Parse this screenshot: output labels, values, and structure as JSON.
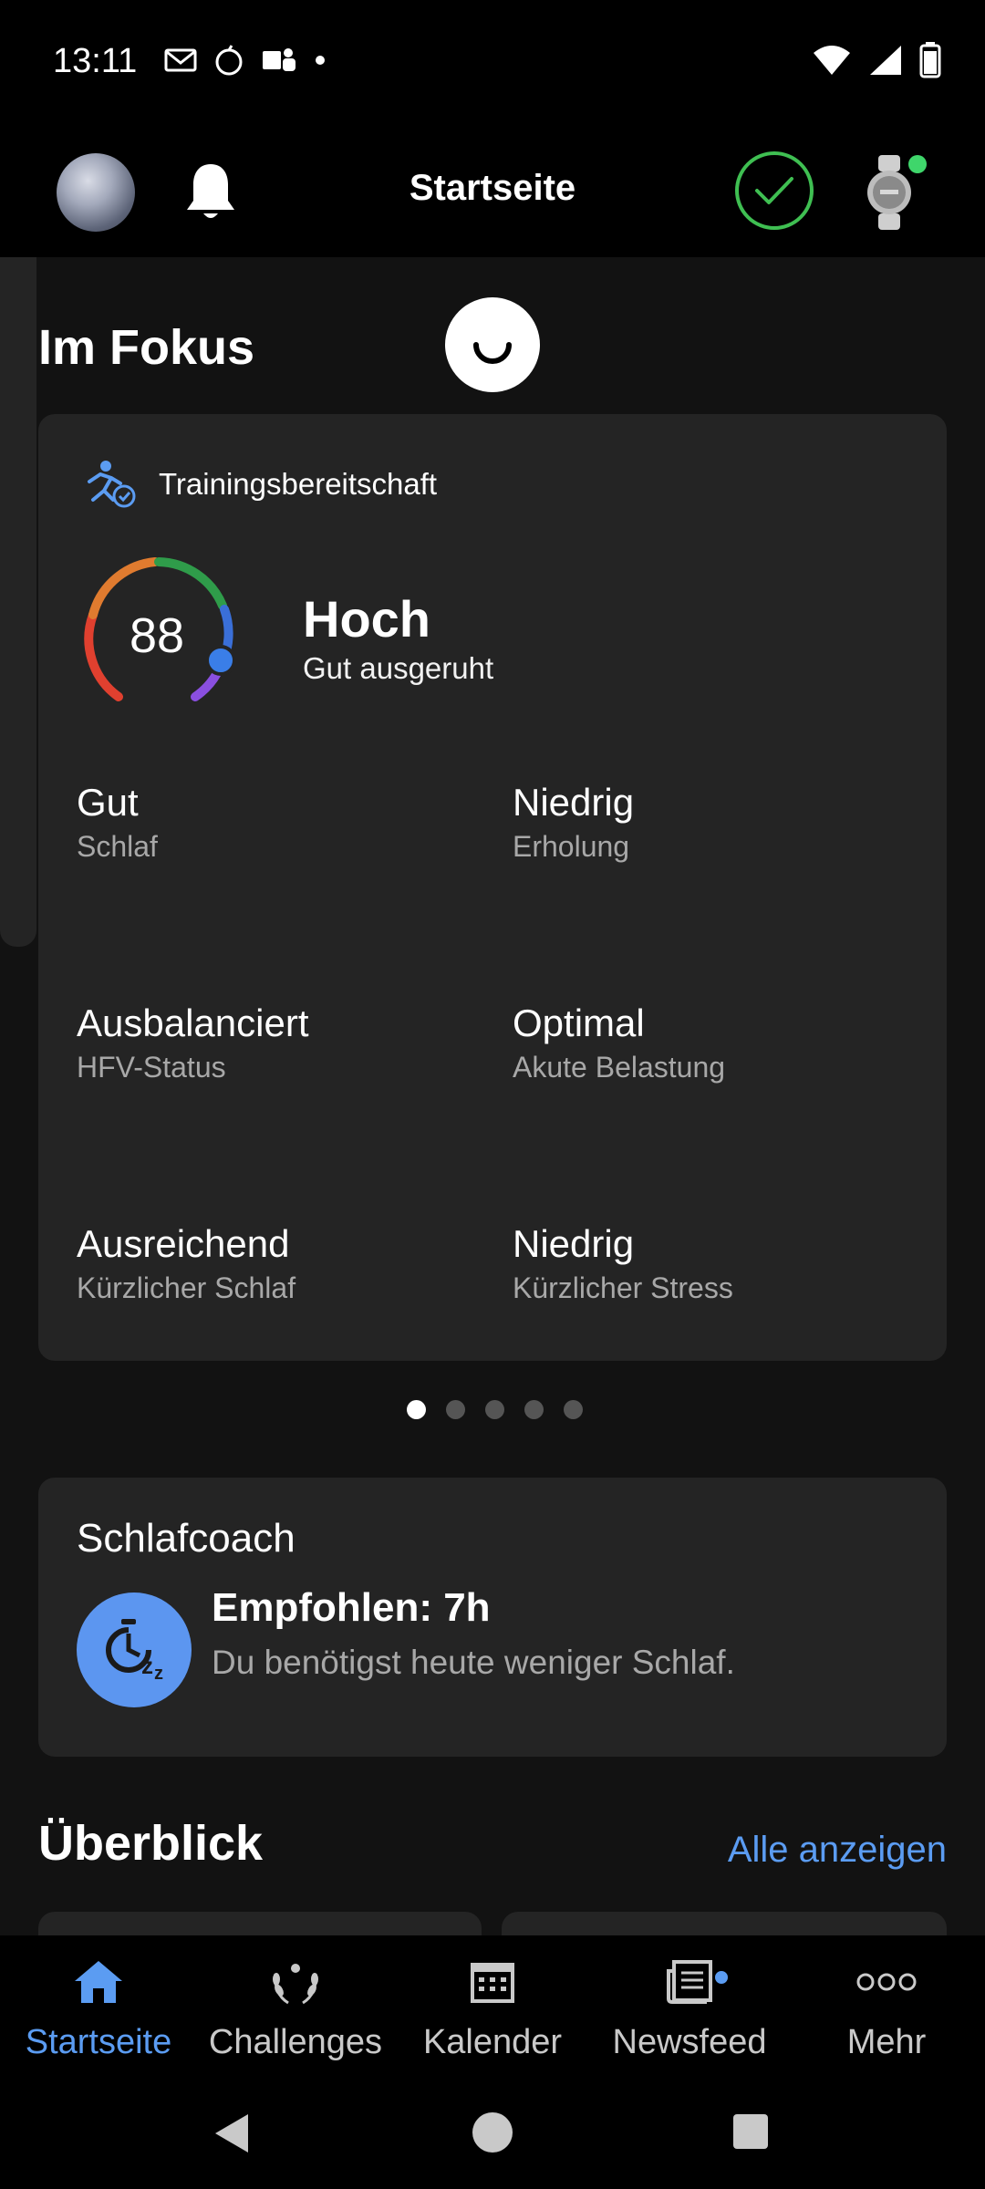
{
  "status_bar": {
    "time": "13:11"
  },
  "app_bar": {
    "title": "Startseite"
  },
  "focus": {
    "title": "Im Fokus",
    "card": {
      "title": "Trainingsbereitschaft",
      "score": "88",
      "level": "Hoch",
      "level_sub": "Gut ausgeruht",
      "metrics": [
        {
          "value": "Gut",
          "label": "Schlaf"
        },
        {
          "value": "Niedrig",
          "label": "Erholung"
        },
        {
          "value": "Ausbalanciert",
          "label": "HFV-Status"
        },
        {
          "value": "Optimal",
          "label": "Akute Belastung"
        },
        {
          "value": "Ausreichend",
          "label": "Kürzlicher Schlaf"
        },
        {
          "value": "Niedrig",
          "label": "Kürzlicher Stress"
        }
      ]
    },
    "page_count": 5,
    "page_active": 1
  },
  "sleep_coach": {
    "title": "Schlafcoach",
    "recommendation": "Empfohlen: 7h",
    "message": "Du benötigst heute weniger Schlaf."
  },
  "overview": {
    "title": "Überblick",
    "link": "Alle anzeigen"
  },
  "bottom_nav": {
    "items": [
      {
        "label": "Startseite",
        "icon": "home-icon"
      },
      {
        "label": "Challenges",
        "icon": "laurel-icon"
      },
      {
        "label": "Kalender",
        "icon": "calendar-icon"
      },
      {
        "label": "Newsfeed",
        "icon": "newsfeed-icon"
      },
      {
        "label": "Mehr",
        "icon": "more-icon"
      }
    ]
  },
  "colors": {
    "accent": "#5b9cf2",
    "success": "#3fbf52",
    "card": "#242424",
    "background": "#121212"
  }
}
